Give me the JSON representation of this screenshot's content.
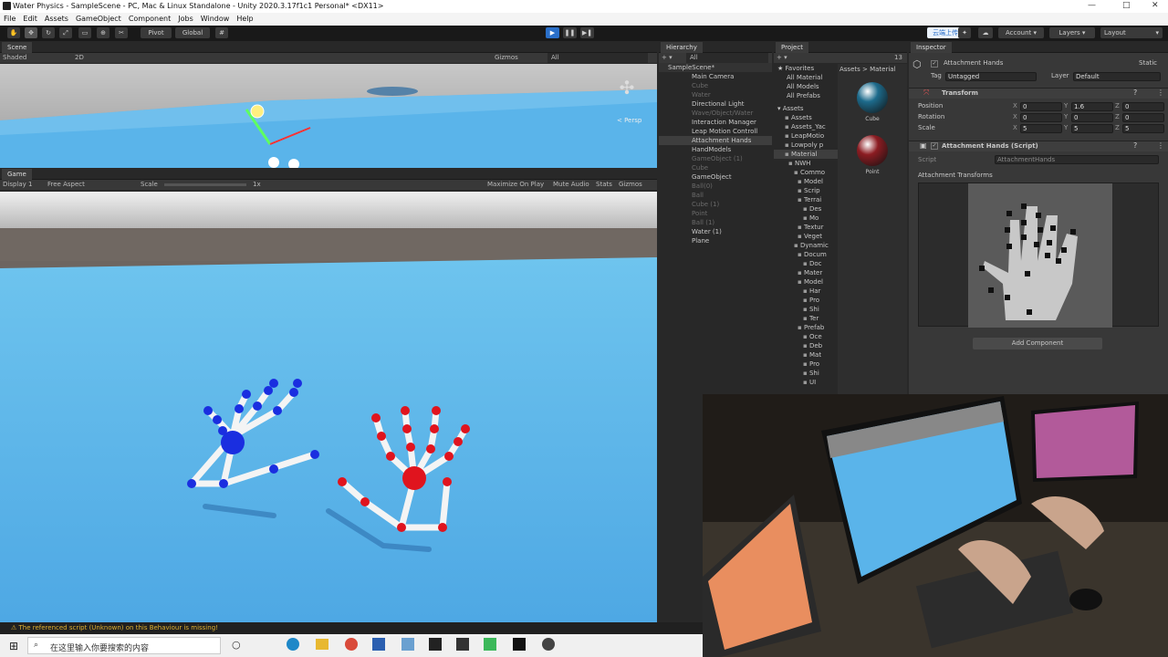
{
  "window": {
    "title": "Water Physics - SampleScene - PC, Mac & Linux Standalone - Unity 2020.3.17f1c1 Personal* <DX11>",
    "min": "—",
    "max": "□",
    "close": "✕"
  },
  "menu": [
    "File",
    "Edit",
    "Assets",
    "GameObject",
    "Component",
    "Jobs",
    "Window",
    "Help"
  ],
  "toolbar": {
    "pivot": "Pivot",
    "global": "Global",
    "account": "Account",
    "layers": "Layers",
    "layout": "Layout",
    "cloud_label": "云端上传"
  },
  "scene": {
    "tab": "Scene",
    "shading": "Shaded",
    "mode2d": "2D",
    "gizmos": "Gizmos",
    "search": "All",
    "persp": "< Persp"
  },
  "game": {
    "tab": "Game",
    "display": "Display 1",
    "aspect": "Free Aspect",
    "scale_label": "Scale",
    "scale_value": "1x",
    "maximize": "Maximize On Play",
    "mute": "Mute Audio",
    "stats": "Stats",
    "gizmos": "Gizmos"
  },
  "hierarchy": {
    "tab": "Hierarchy",
    "search": "All",
    "scene": "SampleScene*",
    "items": [
      {
        "label": "Main Camera",
        "dim": false
      },
      {
        "label": "Cube",
        "dim": true
      },
      {
        "label": "Water",
        "dim": true
      },
      {
        "label": "Directional Light",
        "dim": false
      },
      {
        "label": "Wave/Object/Water",
        "dim": true
      },
      {
        "label": "Interaction Manager",
        "dim": false
      },
      {
        "label": "Leap Motion Controll",
        "dim": false
      },
      {
        "label": "Attachment Hands",
        "dim": false
      },
      {
        "label": "HandModels",
        "dim": false
      },
      {
        "label": "GameObject (1)",
        "dim": true
      },
      {
        "label": "Cube",
        "dim": true
      },
      {
        "label": "GameObject",
        "dim": false
      },
      {
        "label": "Ball(0)",
        "dim": true
      },
      {
        "label": "Ball",
        "dim": true
      },
      {
        "label": "Cube (1)",
        "dim": true
      },
      {
        "label": "Point",
        "dim": true
      },
      {
        "label": "Ball (1)",
        "dim": true
      },
      {
        "label": "Water (1)",
        "dim": false
      },
      {
        "label": "Plane",
        "dim": false
      }
    ]
  },
  "project": {
    "tab": "Project",
    "breadcrumb": "Assets > Material",
    "count": "13",
    "favorites": {
      "label": "Favorites",
      "items": [
        "All Material",
        "All Models",
        "All Prefabs"
      ]
    },
    "assets_label": "Assets",
    "tree": [
      "Assets",
      "Assets_Yac",
      "LeapMotio",
      "Lowpoly p",
      "Material",
      "NWH",
      "Commo",
      "Model",
      "Scrip",
      "Terrai",
      "Des",
      "Mo",
      "Textur",
      "Veget",
      "Dynamic",
      "Docum",
      "Doc",
      "Mater",
      "Model",
      "Har",
      "Pro",
      "Shi",
      "Ter",
      "Prefab",
      "Oce",
      "Deb",
      "Mat",
      "Pro",
      "Shi",
      "UI"
    ],
    "assets": [
      {
        "name": "Cube",
        "color": "#1d6b8c"
      },
      {
        "name": "Point",
        "color": "#8c1c22"
      }
    ]
  },
  "inspector": {
    "tab": "Inspector",
    "object_name": "Attachment Hands",
    "static": "Static",
    "tag_label": "Tag",
    "tag_value": "Untagged",
    "layer_label": "Layer",
    "layer_value": "Default",
    "transform": {
      "title": "Transform",
      "rows": [
        {
          "label": "Position",
          "x": "0",
          "y": "1.6",
          "z": "0"
        },
        {
          "label": "Rotation",
          "x": "0",
          "y": "0",
          "z": "0"
        },
        {
          "label": "Scale",
          "x": "5",
          "y": "5",
          "z": "5"
        }
      ]
    },
    "script": {
      "title": "Attachment Hands (Script)",
      "script_label": "Script",
      "script_value": "AttachmentHands",
      "transforms_label": "Attachment Transforms"
    },
    "add_component": "Add Component"
  },
  "status": "⚠ The referenced script (Unknown) on this Behaviour is missing!",
  "taskbar": {
    "search_placeholder": "在这里输入你要搜索的内容"
  },
  "colors": {
    "sky": "#6ec4ee",
    "plane": "#4ea8e4",
    "accent": "#2a6fc9"
  }
}
